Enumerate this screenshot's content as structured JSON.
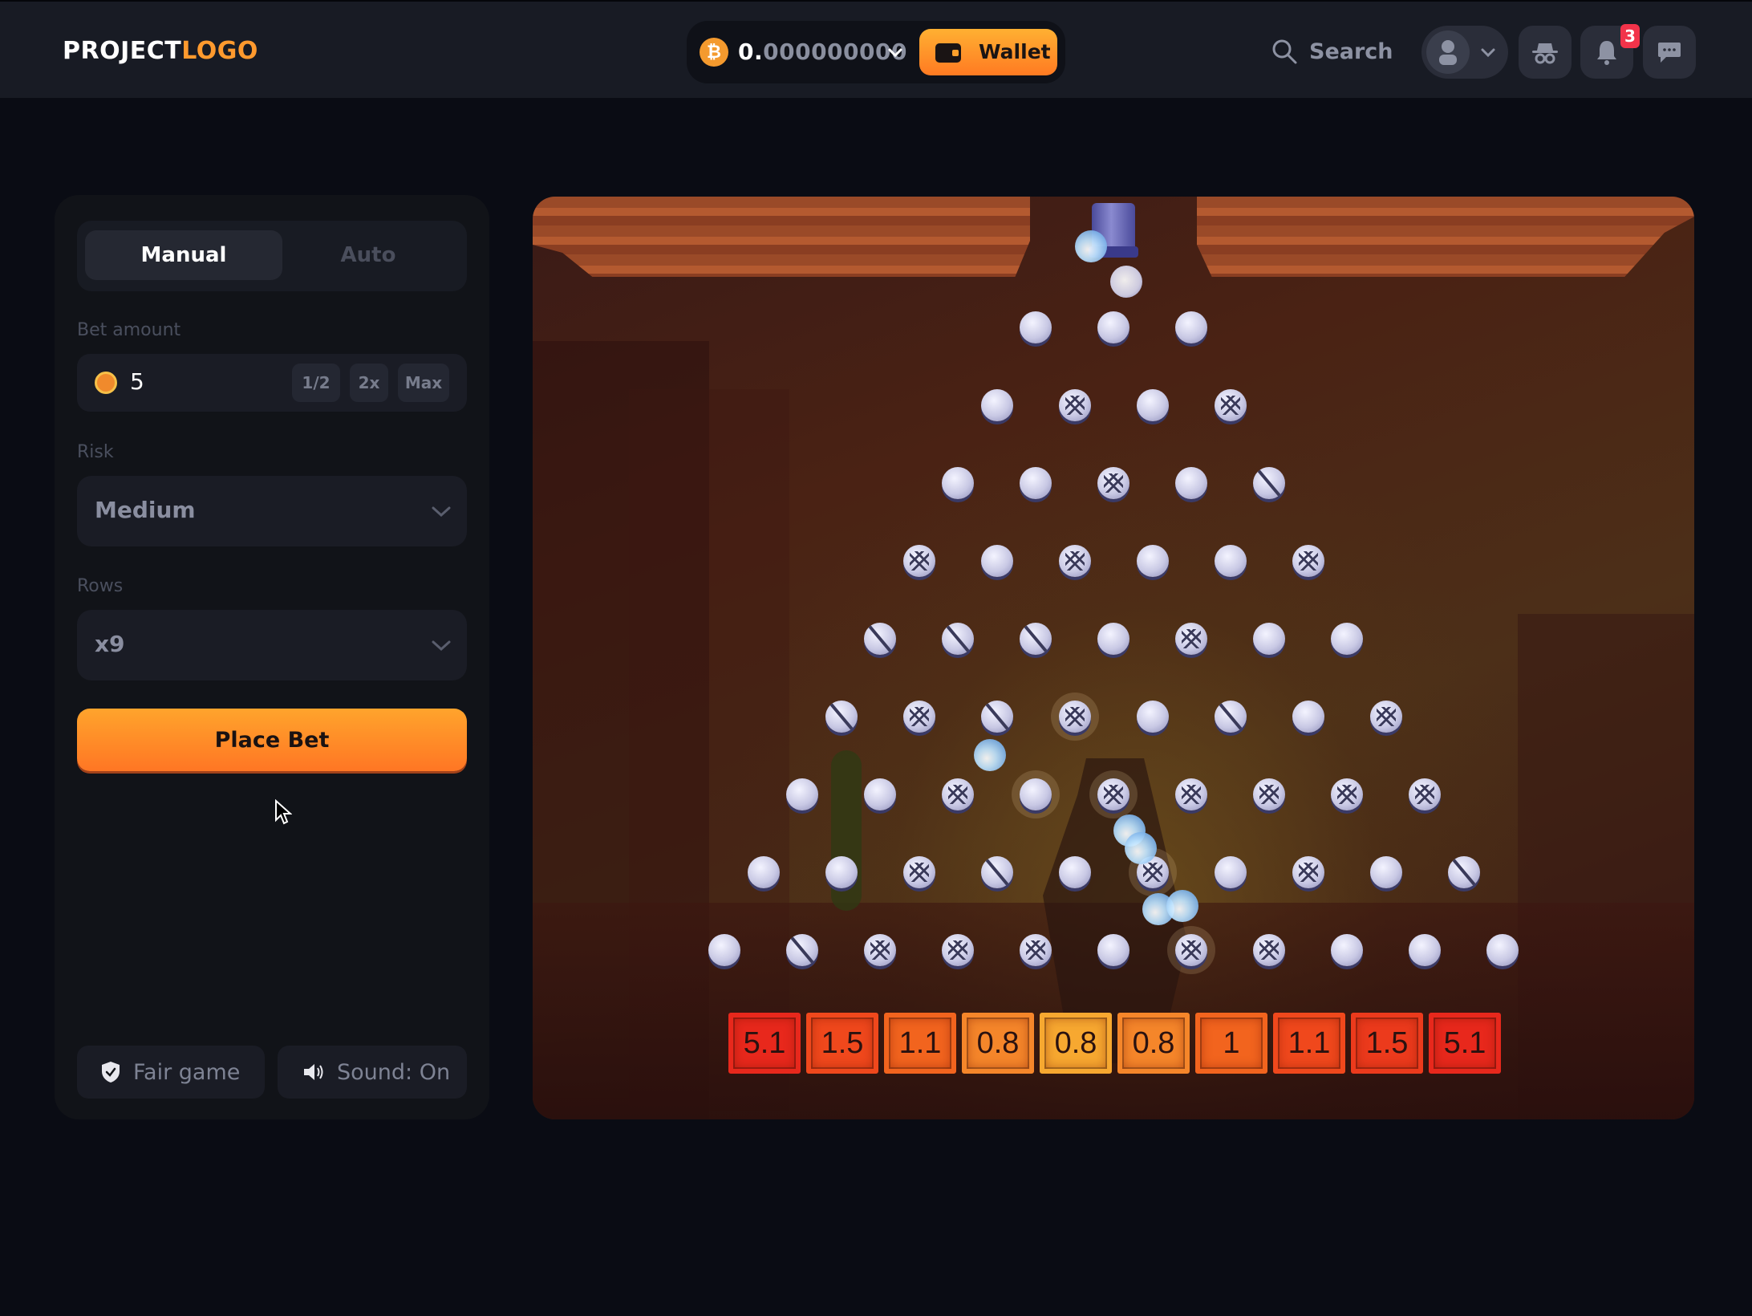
{
  "header": {
    "logo_part1": "PROJECT",
    "logo_part2": "LOGO",
    "balance_integer": "0.",
    "balance_decimal": "000000000",
    "currency_icon": "bitcoin-icon",
    "wallet_label": "Wallet",
    "search_label": "Search",
    "notification_count": "3",
    "accent_color": "#ff9a2e"
  },
  "sidebar": {
    "tabs": [
      {
        "label": "Manual",
        "active": true
      },
      {
        "label": "Auto",
        "active": false
      }
    ],
    "bet_amount_label": "Bet amount",
    "bet_amount_value": "5",
    "bet_modifiers": [
      "1/2",
      "2x",
      "Max"
    ],
    "risk_label": "Risk",
    "risk_value": "Medium",
    "rows_label": "Rows",
    "rows_value": "x9",
    "place_bet_label": "Place Bet",
    "fair_game_label": "Fair game",
    "sound_label": "Sound: On"
  },
  "game": {
    "peg_rows": [
      "ppp",
      "pxpx",
      "ppxps",
      "xpxppx",
      "sssp xpp",
      "sxsxpspx",
      "ppxpxxxxx",
      "ppxspxpxps",
      "psxxxpxxppp"
    ],
    "multipliers": [
      "5.1",
      "1.5",
      "1.1",
      "0.8",
      "0.8",
      "0.8",
      "1",
      "1.1",
      "1.5",
      "5.1"
    ],
    "multiplier_colors": [
      "#e8281c",
      "#f0481c",
      "#f2641e",
      "#f5862a",
      "#f7a830",
      "#f5862a",
      "#f2641e",
      "#f0481c",
      "#ec3a1c",
      "#e8281c"
    ]
  }
}
